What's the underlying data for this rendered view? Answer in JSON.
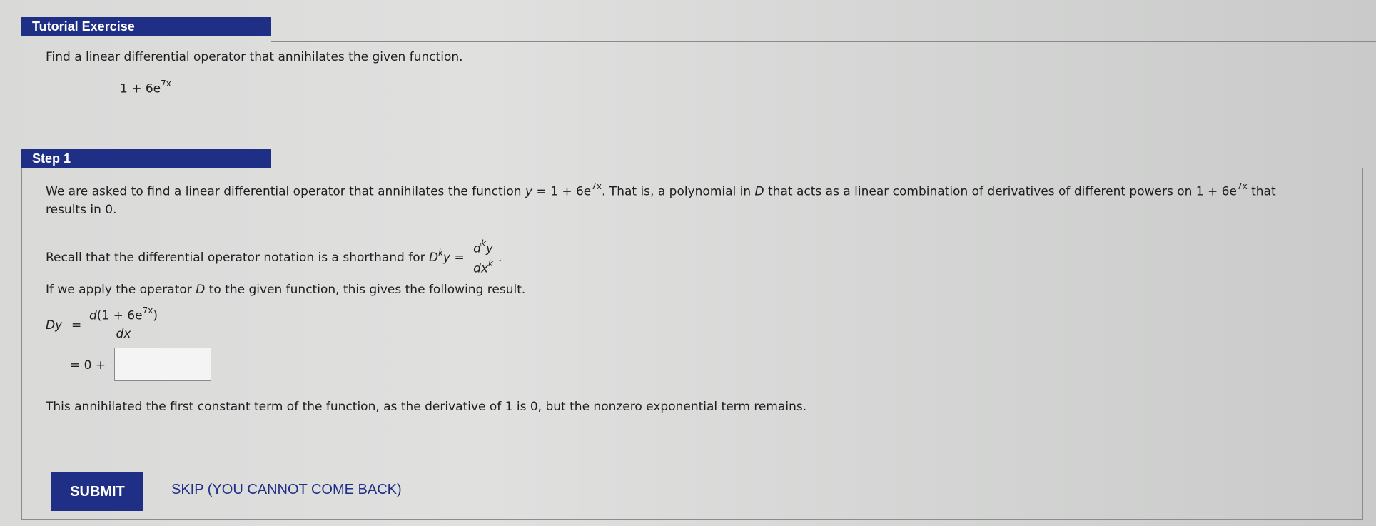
{
  "tutorial": {
    "title": "Tutorial Exercise",
    "prompt": "Find a linear differential operator that annihilates the given function.",
    "function_base": "1 + 6e",
    "function_exp": "7x"
  },
  "step": {
    "title": "Step 1",
    "para1_a": "We are asked to find a linear differential operator that annihilates the function ",
    "para1_y": "y",
    "para1_b": " = 1 + 6e",
    "para1_exp": "7x",
    "para1_c": ". That is, a polynomial in ",
    "para1_D": "D",
    "para1_d": " that acts as a linear combination of derivatives of different powers on 1 + 6e",
    "para1_exp2": "7x",
    "para1_e": " that",
    "para1_line2": "results in 0.",
    "recall_text": "Recall that the differential operator notation is a shorthand for ",
    "recall_D": "D",
    "recall_k": "k",
    "recall_y": "y",
    "recall_eq": " = ",
    "recall_num_d": "d",
    "recall_num_k": "k",
    "recall_num_y": "y",
    "recall_den_dx": "dx",
    "recall_den_k": "k",
    "recall_end": ".",
    "apply_a": "If we apply the operator ",
    "apply_D": "D",
    "apply_b": " to the given function, this gives the following result.",
    "dy_lhs": "Dy",
    "eq_sign": "=",
    "dy_num_a": "d",
    "dy_num_b": "(1 + 6e",
    "dy_num_exp": "7x",
    "dy_num_c": ")",
    "dy_den": "dx",
    "line2_prefix": "= 0 +",
    "answer_value": "",
    "conclusion": "This annihilated the first constant term of the function, as the derivative of 1 is 0, but the nonzero exponential term remains."
  },
  "actions": {
    "submit_label": "SUBMIT",
    "skip_label": "SKIP (YOU CANNOT COME BACK)"
  },
  "colors": {
    "accent": "#1f2f86",
    "background": "#dcdcdb"
  }
}
